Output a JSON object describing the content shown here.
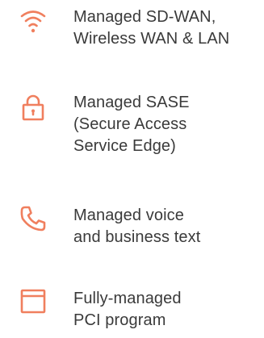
{
  "accent_color": "#f07f5e",
  "features": [
    {
      "icon": "wifi-icon",
      "lines": [
        "Managed SD-WAN,",
        "Wireless WAN & LAN"
      ]
    },
    {
      "icon": "lock-icon",
      "lines": [
        "Managed SASE",
        "(Secure Access",
        "Service Edge)"
      ]
    },
    {
      "icon": "phone-icon",
      "lines": [
        "Managed voice",
        "and business text"
      ]
    },
    {
      "icon": "browser-window-icon",
      "lines": [
        "Fully-managed",
        "PCI program"
      ]
    }
  ]
}
